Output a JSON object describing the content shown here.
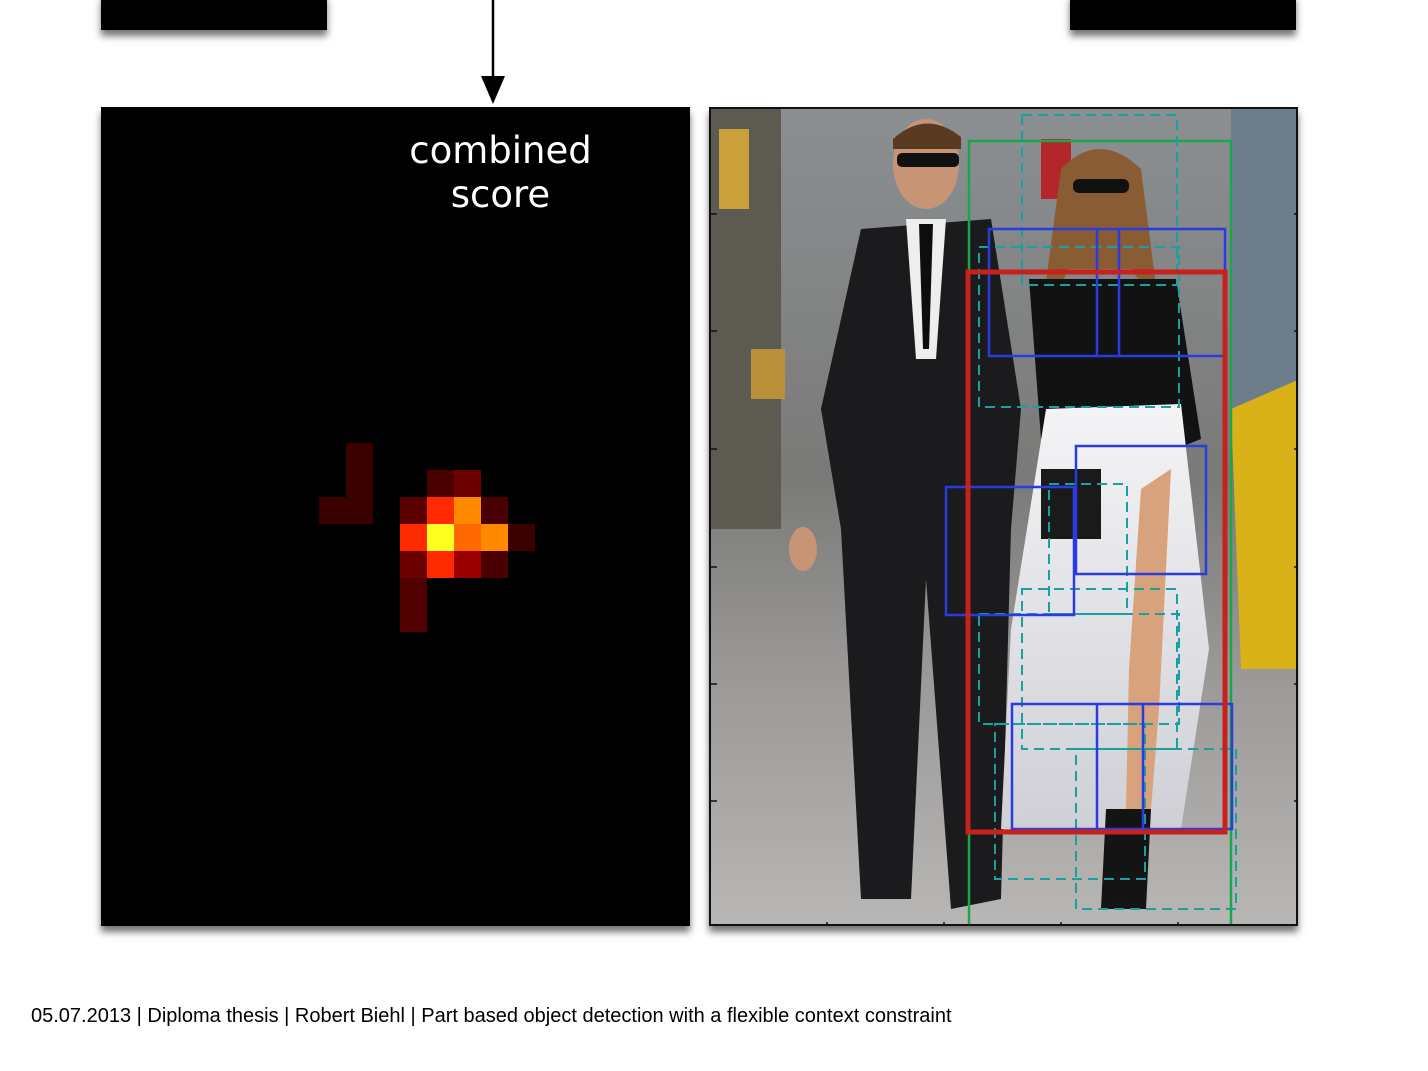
{
  "heatmap": {
    "label_lines": [
      "combined",
      "score"
    ]
  },
  "footer": {
    "text": "05.07.2013 | Diploma thesis | Robert Biehl | Part based object detection with a flexible context constraint"
  },
  "colors": {
    "root_box": "#c8201c",
    "part_box": "#2a3be0",
    "context_box": "#1aa64a",
    "dashed_box": "#1aa0a0"
  }
}
